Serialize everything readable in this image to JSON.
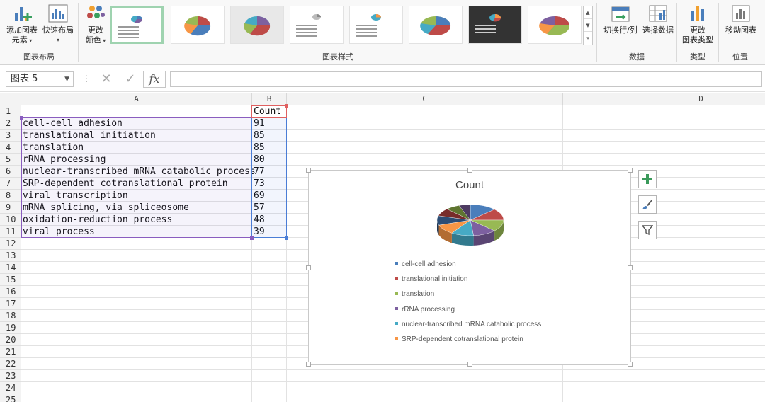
{
  "ribbon": {
    "add_element": {
      "line1": "添加图表",
      "line2": "元素"
    },
    "quick_layout": "快速布局",
    "group_layout": "图表布局",
    "change_colors": {
      "line1": "更改",
      "line2": "颜色"
    },
    "group_styles": "图表样式",
    "switch_row_col": "切换行/列",
    "select_data": "选择数据",
    "group_data": "数据",
    "change_type": {
      "line1": "更改",
      "line2": "图表类型"
    },
    "group_type": "类型",
    "move_chart": "移动图表",
    "group_location": "位置"
  },
  "formula_bar": {
    "name_box": "图表 5",
    "fx": "fx",
    "value": ""
  },
  "columns": [
    "A",
    "B",
    "C",
    "D"
  ],
  "rows": [
    {
      "n": "1",
      "a": "",
      "b": "Count"
    },
    {
      "n": "2",
      "a": "cell-cell adhesion",
      "b": "91"
    },
    {
      "n": "3",
      "a": "translational initiation",
      "b": "85"
    },
    {
      "n": "4",
      "a": "translation",
      "b": "85"
    },
    {
      "n": "5",
      "a": "rRNA processing",
      "b": "80"
    },
    {
      "n": "6",
      "a": "nuclear-transcribed mRNA catabolic process",
      "b": "77"
    },
    {
      "n": "7",
      "a": "SRP-dependent cotranslational protein",
      "b": "73"
    },
    {
      "n": "8",
      "a": "viral transcription",
      "b": "69"
    },
    {
      "n": "9",
      "a": "mRNA splicing, via spliceosome",
      "b": "57"
    },
    {
      "n": "10",
      "a": "oxidation-reduction process",
      "b": "48"
    },
    {
      "n": "11",
      "a": "viral process",
      "b": "39"
    },
    {
      "n": "12",
      "a": "",
      "b": ""
    },
    {
      "n": "13",
      "a": "",
      "b": ""
    },
    {
      "n": "14",
      "a": "",
      "b": ""
    },
    {
      "n": "15",
      "a": "",
      "b": ""
    },
    {
      "n": "16",
      "a": "",
      "b": ""
    },
    {
      "n": "17",
      "a": "",
      "b": ""
    },
    {
      "n": "18",
      "a": "",
      "b": ""
    },
    {
      "n": "19",
      "a": "",
      "b": ""
    },
    {
      "n": "20",
      "a": "",
      "b": ""
    },
    {
      "n": "21",
      "a": "",
      "b": ""
    },
    {
      "n": "22",
      "a": "",
      "b": ""
    },
    {
      "n": "23",
      "a": "",
      "b": ""
    },
    {
      "n": "24",
      "a": "",
      "b": ""
    },
    {
      "n": "25",
      "a": "",
      "b": ""
    }
  ],
  "chart_data": {
    "type": "pie",
    "title": "Count",
    "categories": [
      "cell-cell adhesion",
      "translational initiation",
      "translation",
      "rRNA processing",
      "nuclear-transcribed mRNA catabolic process",
      "SRP-dependent cotranslational protein",
      "viral transcription",
      "mRNA splicing, via spliceosome",
      "oxidation-reduction process",
      "viral process"
    ],
    "values": [
      91,
      85,
      85,
      80,
      77,
      73,
      69,
      57,
      48,
      39
    ],
    "colors": [
      "#4a7ebb",
      "#be4b48",
      "#98b954",
      "#7d60a0",
      "#46aac5",
      "#f79646",
      "#2c4d75",
      "#772c2a",
      "#5f7530",
      "#4d3b62"
    ],
    "legend_visible_count": 6,
    "legend_position": "bottom",
    "style": "3d"
  }
}
